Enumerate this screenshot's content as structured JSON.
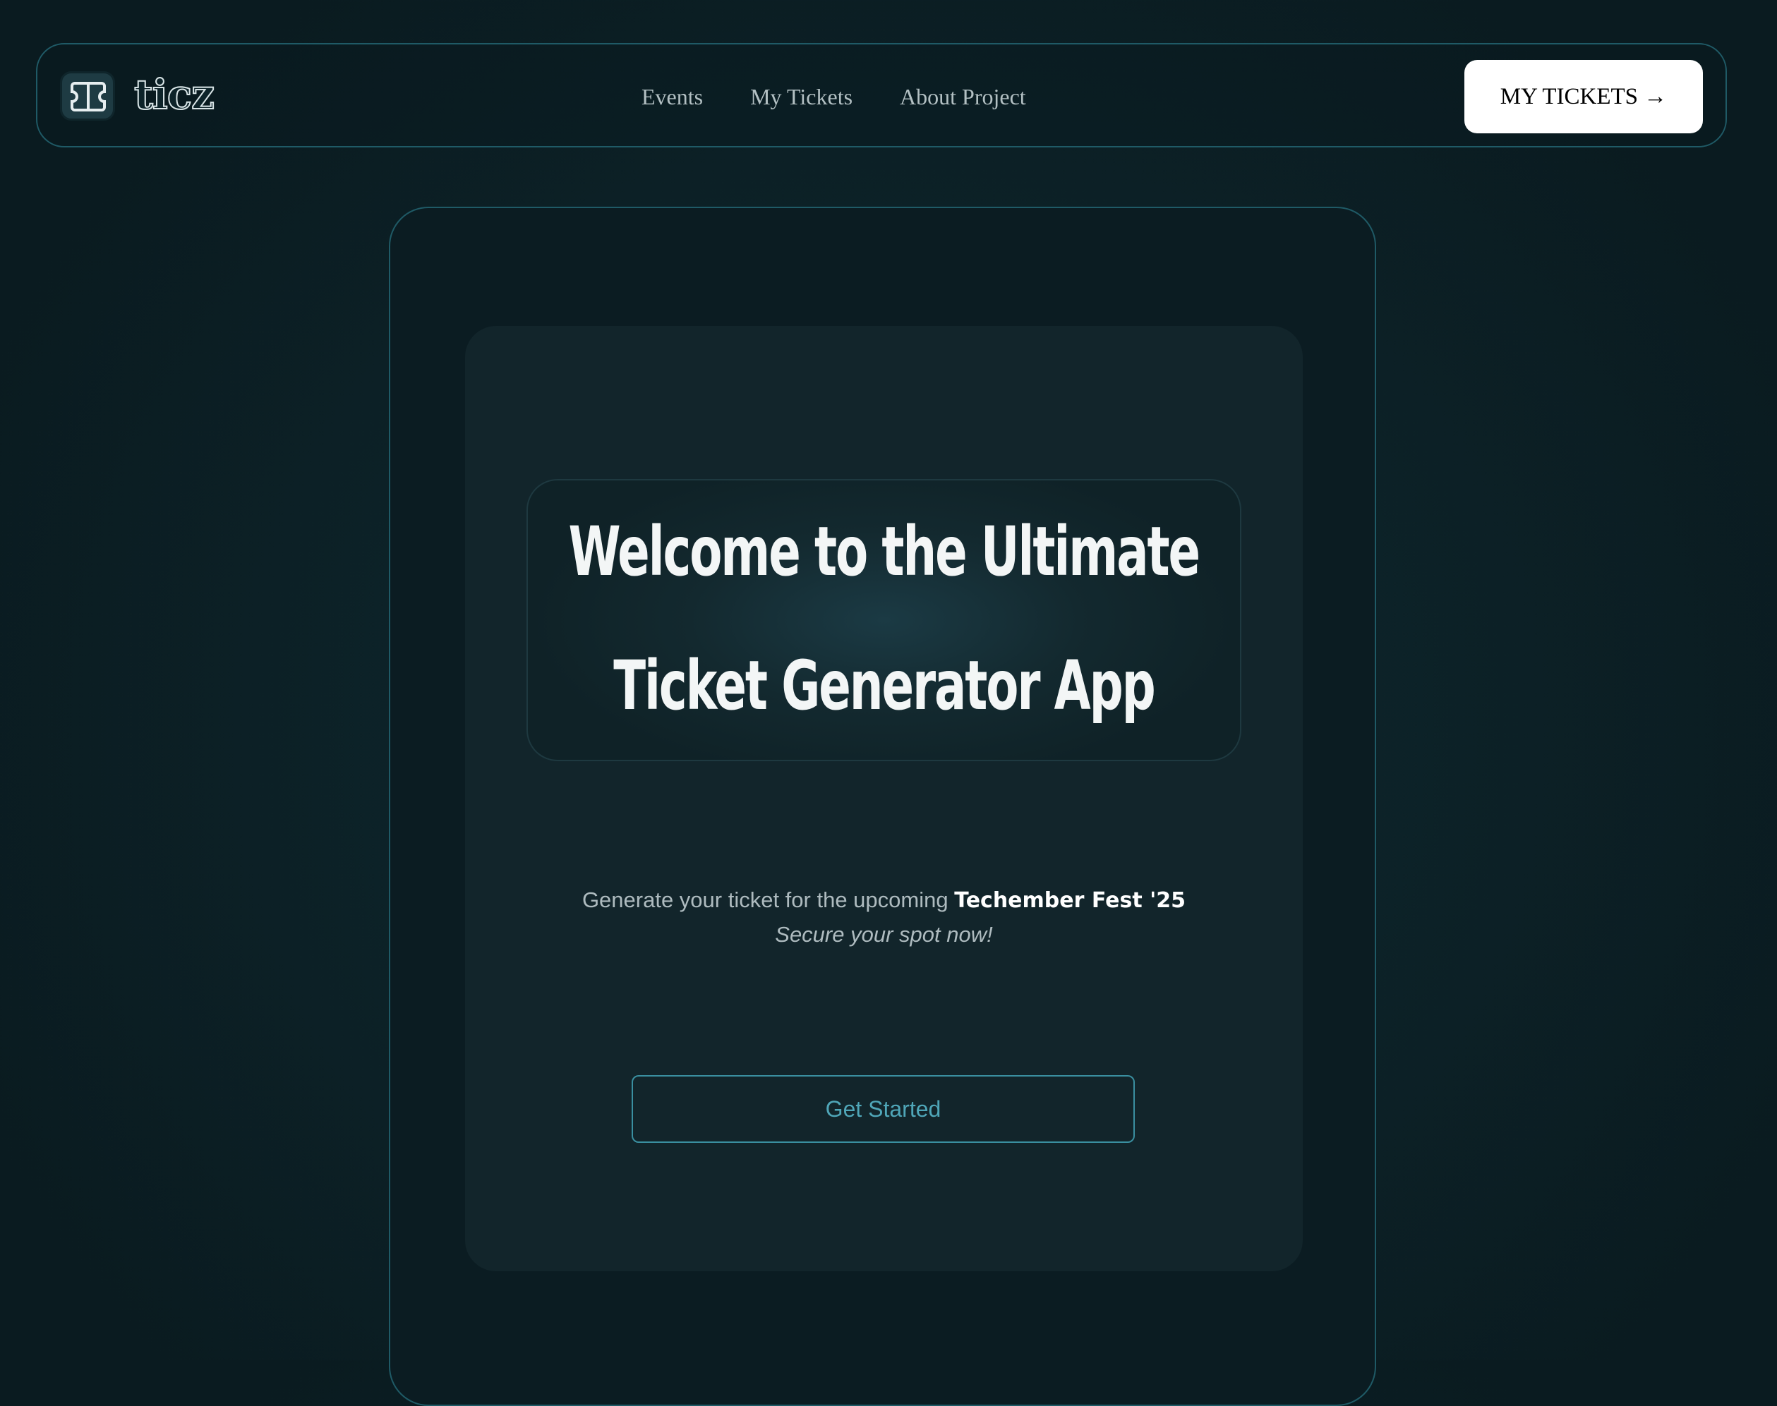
{
  "header": {
    "logo_text": "ticz",
    "nav": [
      {
        "label": "Events"
      },
      {
        "label": "My Tickets"
      },
      {
        "label": "About Project"
      }
    ],
    "cta_label": "MY TICKETS →"
  },
  "hero": {
    "title_line1": "Welcome to the Ultimate",
    "title_line2": "Ticket Generator App",
    "subtitle_prefix": "Generate your ticket for the upcoming ",
    "event_name": "Techember Fest '25",
    "tagline": "Secure your spot now!",
    "button_label": "Get Started"
  },
  "colors": {
    "background": "#0d2329",
    "panel_border": "#1f5a66",
    "accent": "#4fa6b8",
    "cta_background": "#ffffff"
  }
}
